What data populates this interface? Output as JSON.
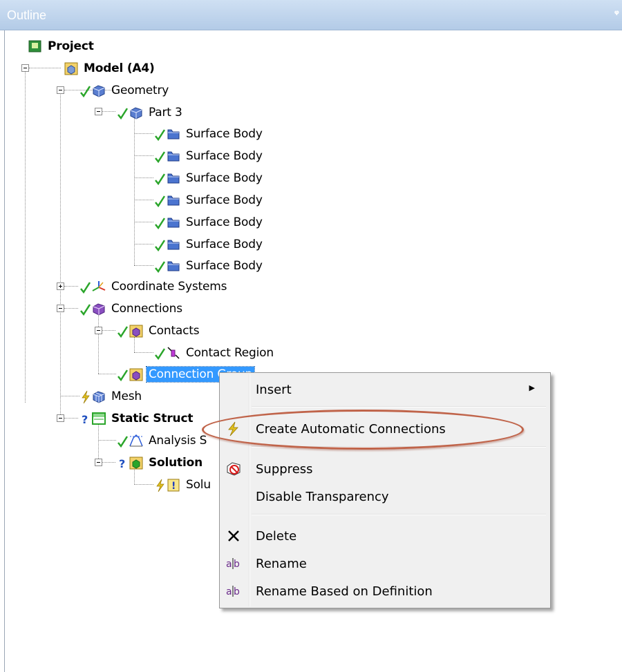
{
  "panel": {
    "title": "Outline",
    "pin_icon": "pin-icon"
  },
  "tree": {
    "project": "Project",
    "model": "Model (A4)",
    "geometry": "Geometry",
    "part": "Part 3",
    "bodies": [
      "Surface Body",
      "Surface Body",
      "Surface Body",
      "Surface Body",
      "Surface Body",
      "Surface Body",
      "Surface Body"
    ],
    "coordinate_systems": "Coordinate Systems",
    "connections": "Connections",
    "contacts": "Contacts",
    "contact_region": "Contact Region",
    "connection_group": "Connection Group",
    "mesh": "Mesh",
    "static_structural": "Static Struct",
    "analysis_settings": "Analysis S",
    "solution": "Solution",
    "solution_information": "Solu"
  },
  "context_menu": {
    "insert": "Insert",
    "create_automatic_connections": "Create Automatic Connections",
    "suppress": "Suppress",
    "disable_transparency": "Disable Transparency",
    "delete": "Delete",
    "rename": "Rename",
    "rename_based_on_definition": "Rename Based on Definition"
  },
  "colors": {
    "selection": "#3399ff",
    "check": "#2aa52a",
    "lightning": "#e0c020",
    "highlight_oval": "#c0644a",
    "title_bar": "#b3cbe7"
  }
}
